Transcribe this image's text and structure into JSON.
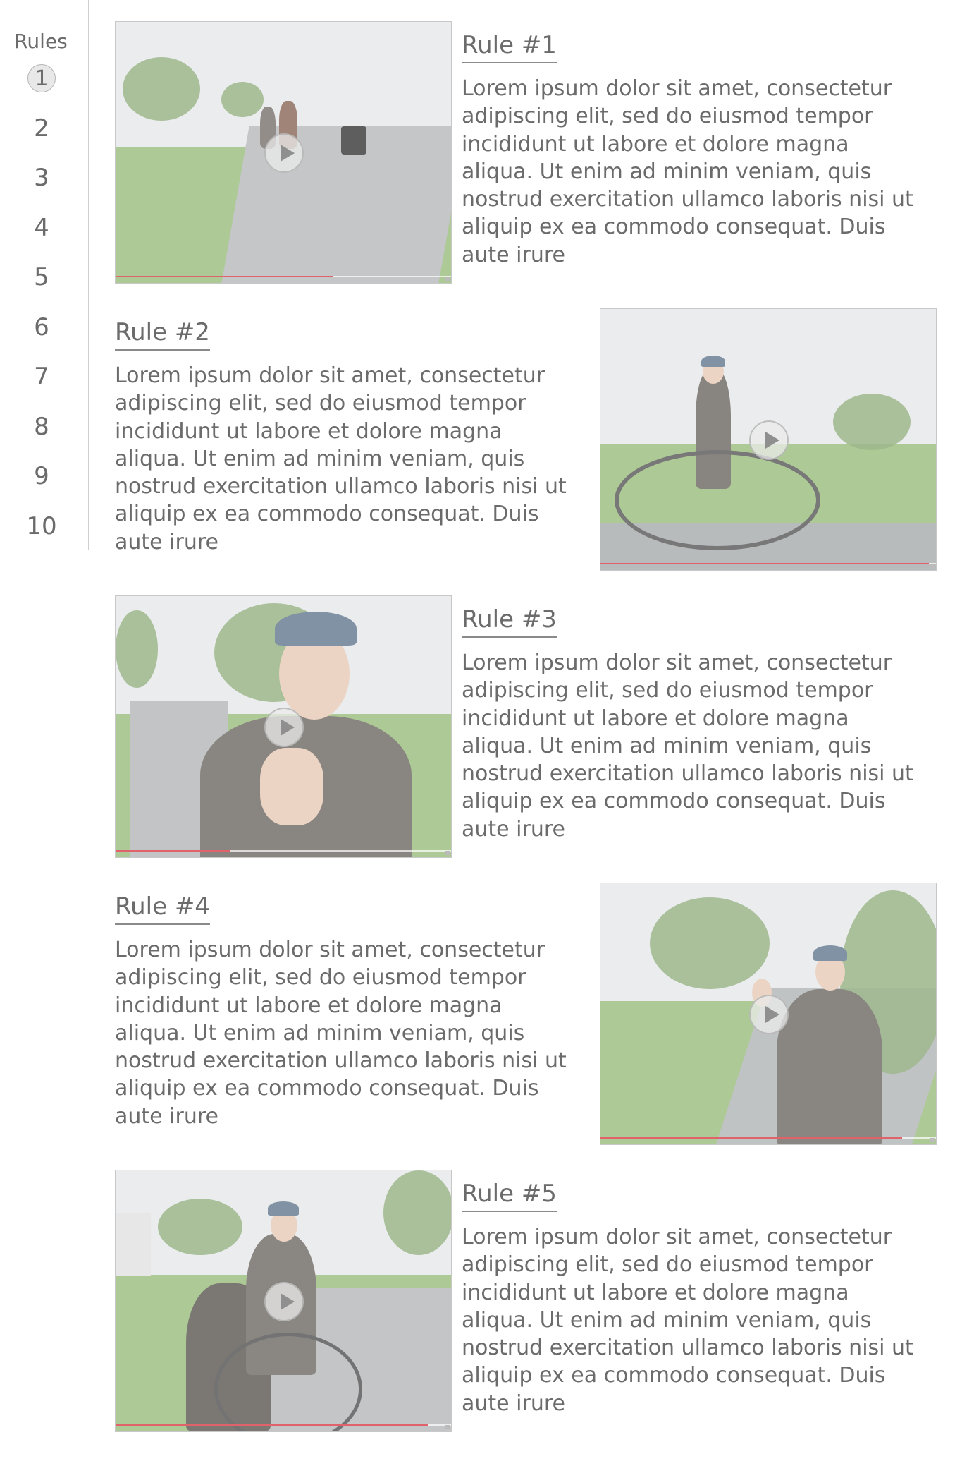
{
  "sidebar": {
    "title": "Rules",
    "items": [
      {
        "label": "1",
        "active": true
      },
      {
        "label": "2"
      },
      {
        "label": "3"
      },
      {
        "label": "4"
      },
      {
        "label": "5"
      },
      {
        "label": "6"
      },
      {
        "label": "7"
      },
      {
        "label": "8"
      },
      {
        "label": "9"
      },
      {
        "label": "10"
      }
    ]
  },
  "rules": [
    {
      "title": "Rule #1",
      "body": "Lorem ipsum dolor sit amet, consectetur adipiscing elit, sed do eiusmod tempor incididunt ut labore et dolore magna aliqua. Ut enim ad minim veniam, quis nostrud exercitation ullamco laboris nisi ut aliquip ex ea commodo consequat. Duis aute irure",
      "video": {
        "progress": 0.65,
        "scene": "two cyclists on a path"
      }
    },
    {
      "title": "Rule #2",
      "body": "Lorem ipsum dolor sit amet, consectetur adipiscing elit, sed do eiusmod tempor incididunt ut labore et dolore magna aliqua. Ut enim ad minim veniam, quis nostrud exercitation ullamco laboris nisi ut aliquip ex ea commodo consequat. Duis aute irure",
      "video": {
        "progress": 0.98,
        "scene": "man walking a bicycle"
      }
    },
    {
      "title": "Rule #3",
      "body": "Lorem ipsum dolor sit amet, consectetur adipiscing elit, sed do eiusmod tempor incididunt ut labore et dolore magna aliqua. Ut enim ad minim veniam, quis nostrud exercitation ullamco laboris nisi ut aliquip ex ea commodo consequat. Duis aute irure",
      "video": {
        "progress": 0.34,
        "scene": "smiling man giving thumbs up"
      }
    },
    {
      "title": "Rule #4",
      "body": "Lorem ipsum dolor sit amet, consectetur adipiscing elit, sed do eiusmod tempor incididunt ut labore et dolore magna aliqua. Ut enim ad minim veniam, quis nostrud exercitation ullamco laboris nisi ut aliquip ex ea commodo consequat. Duis aute irure",
      "video": {
        "progress": 0.9,
        "scene": "man waving on a path"
      }
    },
    {
      "title": "Rule #5",
      "body": "Lorem ipsum dolor sit amet, consectetur adipiscing elit, sed do eiusmod tempor incididunt ut labore et dolore magna aliqua. Ut enim ad minim veniam, quis nostrud exercitation ullamco laboris nisi ut aliquip ex ea commodo consequat. Duis aute irure",
      "video": {
        "progress": 0.93,
        "scene": "two people riding one bicycle"
      }
    }
  ],
  "colors": {
    "text": "#6b6b6b",
    "progress": "#e0626a",
    "border": "#cfcfcf"
  },
  "icons": {
    "play": "play-icon"
  }
}
